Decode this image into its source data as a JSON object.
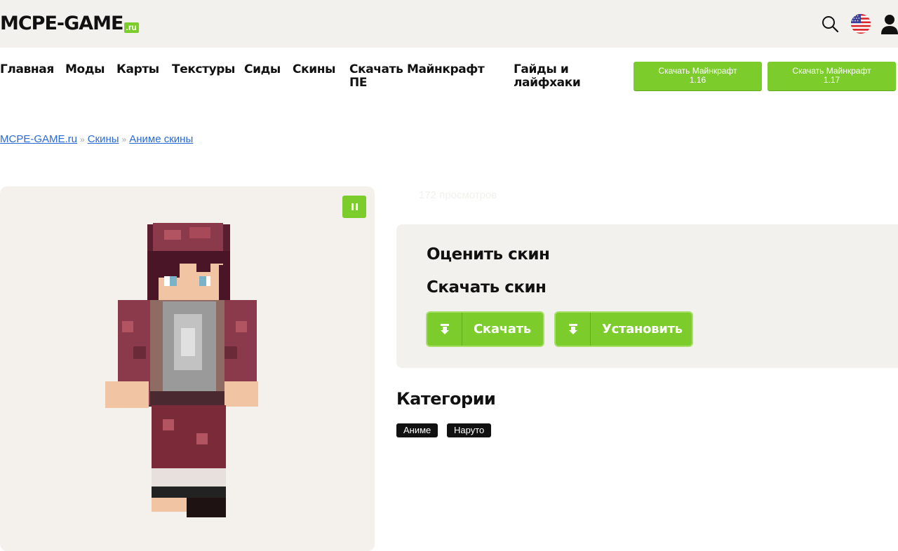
{
  "header": {
    "logo_text": "MCPE-GAME",
    "logo_tld": ".ru",
    "icons": [
      "search-icon",
      "us-flag-icon",
      "user-icon"
    ]
  },
  "nav": {
    "items": [
      {
        "label": "Главная"
      },
      {
        "label": "Моды"
      },
      {
        "label": "Карты"
      },
      {
        "label": "Текстуры"
      },
      {
        "label": "Сиды"
      },
      {
        "label": "Скины"
      },
      {
        "label": "Скачать Майнкрафт\nПЕ"
      },
      {
        "label": "Гайды и\nлайфхаки"
      }
    ],
    "download_buttons": [
      {
        "label": "Скачать Майнкрафт\n1.16"
      },
      {
        "label": "Скачать Майнкрафт\n1.17"
      }
    ]
  },
  "breadcrumb": {
    "items": [
      "MCPE-GAME.ru",
      "Скины",
      "Аниме скины"
    ],
    "separator": "»"
  },
  "skin": {
    "views": "172 просмотров",
    "rate_title": "Оценить скин",
    "download_title": "Скачать скин",
    "download_label": "Скачать",
    "install_label": "Установить"
  },
  "categories": {
    "title": "Категории",
    "tags": [
      "Аниме",
      "Наруто"
    ]
  },
  "colors": {
    "accent": "#7ccc2c",
    "header_bg": "#f3f1ed",
    "link": "#2a6ad6"
  }
}
